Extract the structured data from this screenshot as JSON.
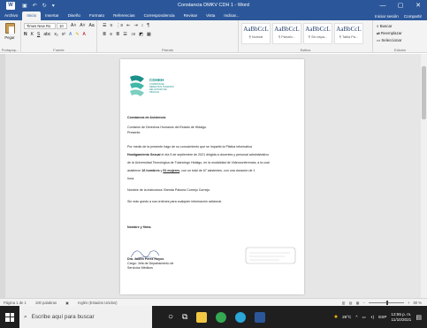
{
  "window": {
    "title": "Constancia DMKV CDH 1 - Word",
    "controls": [
      "—",
      "▢",
      "✕"
    ]
  },
  "tabs": {
    "items": [
      "Archivo",
      "Inicio",
      "Insertar",
      "Diseño",
      "Formato",
      "Referencias",
      "Correspondencia",
      "Revisar",
      "Vista",
      "Indicar..."
    ],
    "active_index": 1,
    "signin": "Iniciar sesión",
    "share": "Compartir"
  },
  "ribbon": {
    "paste_label": "Pegar",
    "font_name": "Times New Ro",
    "font_size": "10",
    "groups": {
      "clipboard": "Portapap...",
      "font": "Fuente",
      "paragraph": "Párrafo",
      "styles": "Estilos",
      "editing": "Edición"
    },
    "styles": [
      {
        "sample": "AaBbCcL",
        "name": "¶ Normal"
      },
      {
        "sample": "AaBbCcL",
        "name": "¶ Párrafo..."
      },
      {
        "sample": "AaBbCcL",
        "name": "¶ Sin espa..."
      },
      {
        "sample": "AaBbCcL",
        "name": "¶ Tabla Pa..."
      }
    ],
    "editing_items": [
      "Buscar",
      "Reemplazar",
      "Seleccionar"
    ]
  },
  "document": {
    "logo_name": "CDHEH",
    "logo_sub": "COMISIÓN DE DERECHOS HUMANOS DEL ESTADO DE HIDALGO",
    "heading": "Constancia de Asistencia",
    "recipient": "Comisión de Derechos Humanos del Estado de Hidalgo.",
    "presente": "Presente.",
    "p1_a": "Por medio de la presente hago de su conocimiento que se impartió la Plática informativa",
    "p1_b_bold": "Hostigamiento Sexual",
    "p1_c": "el día 5 de septiembre de 2021 dirigida a docentes y personal administrativo",
    "p2": "de la Universidad Tecnológica de Tulancingo Hidalgo, en la modalidad de Videoconferencia, a la cual",
    "p3_a": "asistieron",
    "p3_b_bold": "16 hombres",
    "p3_c": "y",
    "p3_d_underline": "51 mujeres",
    "p3_e": ", con un total de 67 asistentes, con una duración de 1",
    "p4": "hora.",
    "instructor": "Nombre de la instructora: Brenda Paloma Cornejo Cornejo",
    "closing": "Sin más quedo a sus órdenes para cualquier información adicional.",
    "signature_label": "Nombre y firma.",
    "signer_name": "Dra. Judith Pérez Hoyos",
    "signer_role": "Cargo: Jefa de Departamento de",
    "signer_dept": "Servicios Médicos"
  },
  "status": {
    "page": "Página 1 de 1",
    "words": "100 palabras",
    "lang": "Inglés (Estados Unidos)",
    "zoom": "80 %"
  },
  "taskbar": {
    "search_placeholder": "Escribe aquí para buscar",
    "weather": "26°C",
    "lang": "ESP",
    "time": "12:55 p. m.",
    "date": "11/10/2021"
  },
  "colors": {
    "word_blue": "#2b579a",
    "logo_teal": "#1b8f8a"
  }
}
